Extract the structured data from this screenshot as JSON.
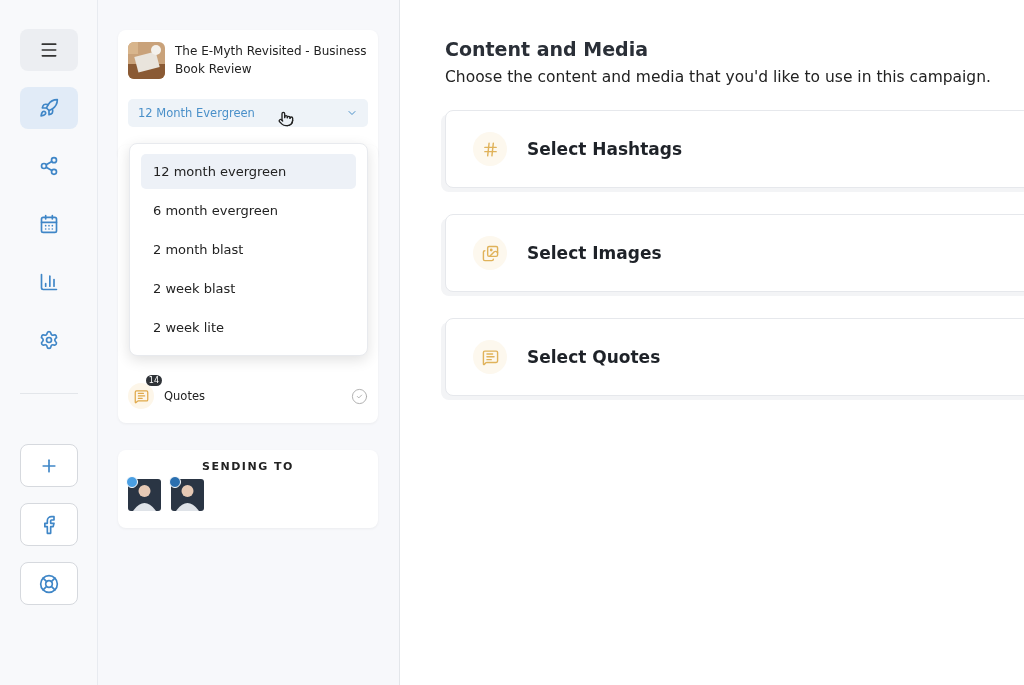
{
  "rail": {
    "items": [
      {
        "kind": "rocket",
        "selected": true
      },
      {
        "kind": "network",
        "selected": false
      },
      {
        "kind": "calendar",
        "selected": false
      },
      {
        "kind": "chart",
        "selected": false
      },
      {
        "kind": "settings",
        "selected": false
      }
    ],
    "actions": [
      {
        "kind": "add"
      },
      {
        "kind": "facebook"
      },
      {
        "kind": "help"
      }
    ]
  },
  "campaign": {
    "title": "The E-Myth Revisited - Business Book Review",
    "schedule": {
      "value": "12 Month Evergreen",
      "options": [
        {
          "label": "12 month evergreen",
          "selected": true
        },
        {
          "label": "6 month evergreen",
          "selected": false
        },
        {
          "label": "2 month blast",
          "selected": false
        },
        {
          "label": "2 week blast",
          "selected": false
        },
        {
          "label": "2 week lite",
          "selected": false
        }
      ]
    }
  },
  "content_items": [
    {
      "label": "Quotes",
      "count": "14",
      "checked": false
    }
  ],
  "sending_to": {
    "title": "SENDING TO",
    "recipients": [
      {
        "color": "#4a9fe3"
      },
      {
        "color": "#2a6fb0"
      }
    ]
  },
  "main": {
    "title": "Content and Media",
    "subtitle": "Choose the content and media that you'd like to use in this campaign.",
    "cards": [
      {
        "kind": "hashtags",
        "label": "Select Hashtags"
      },
      {
        "kind": "images",
        "label": "Select Images"
      },
      {
        "kind": "quotes",
        "label": "Select Quotes"
      }
    ]
  }
}
